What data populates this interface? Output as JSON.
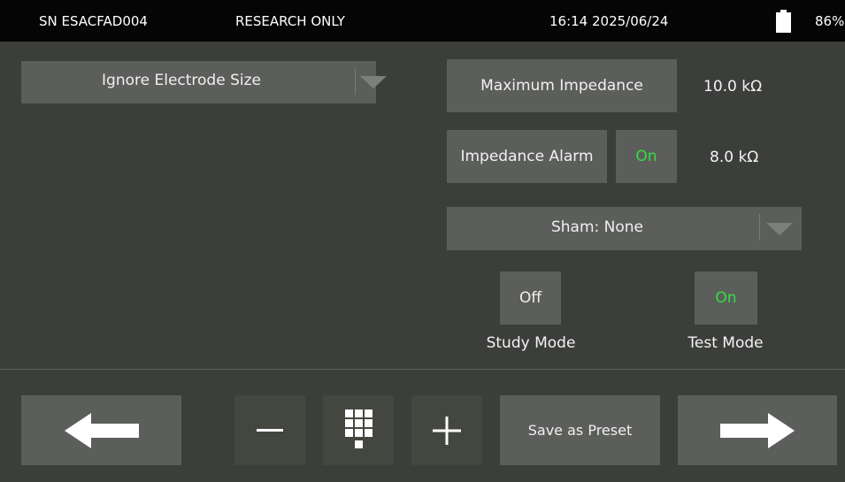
{
  "status_bar": {
    "serial": "SN ESACFAD004",
    "mode_notice": "RESEARCH ONLY",
    "datetime": "16:14 2025/06/24",
    "battery_percent": "86%",
    "battery_icon": "battery-icon"
  },
  "electrode_size": {
    "selected": "Ignore Electrode Size"
  },
  "impedance": {
    "max_label": "Maximum Impedance",
    "max_value": "10.0 kΩ",
    "alarm_label": "Impedance Alarm",
    "alarm_state": "On",
    "alarm_value": "8.0 kΩ"
  },
  "sham": {
    "selected": "Sham: None"
  },
  "study_mode": {
    "state": "Off",
    "caption": "Study Mode"
  },
  "test_mode": {
    "state": "On",
    "caption": "Test Mode"
  },
  "bottom_bar": {
    "back_icon": "arrow-left-icon",
    "minus_icon": "minus-icon",
    "keypad_icon": "keypad-icon",
    "plus_icon": "plus-icon",
    "save_preset_label": "Save as Preset",
    "next_icon": "arrow-right-icon"
  },
  "colors": {
    "background": "#3c3e3b",
    "button": "#5c5e5b",
    "button_dark": "#44473f",
    "status_bar": "#050505",
    "on_green": "#33dd44"
  }
}
